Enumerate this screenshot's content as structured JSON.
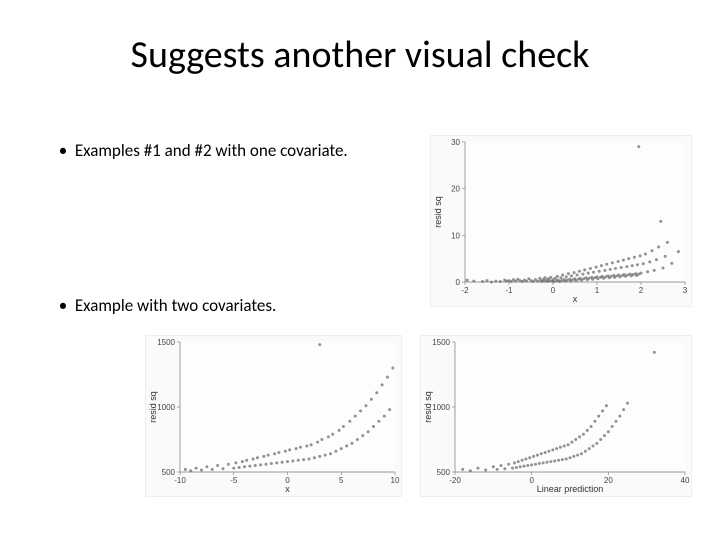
{
  "title": "Suggests another visual check",
  "bullets": {
    "b1": "Examples #1 and #2 with one covariate.",
    "b2": "Example with two covariates."
  },
  "chart_data": [
    {
      "type": "scatter",
      "title": "",
      "xlabel": "x",
      "ylabel": "resid sq",
      "xlim": [
        -2,
        3
      ],
      "ylim": [
        0,
        30
      ],
      "xticks": [
        -2,
        -1,
        0,
        1,
        2,
        3
      ],
      "yticks": [
        0,
        10,
        20,
        30
      ],
      "series": [
        {
          "name": "resid sq",
          "points": [
            [
              -1.95,
              0.4
            ],
            [
              -1.8,
              0.2
            ],
            [
              -1.6,
              0.1
            ],
            [
              -1.5,
              0.3
            ],
            [
              -1.4,
              0.0
            ],
            [
              -1.3,
              0.2
            ],
            [
              -1.2,
              0.1
            ],
            [
              -1.1,
              0.4
            ],
            [
              -1.05,
              0.2
            ],
            [
              -1.0,
              0.3
            ],
            [
              -0.95,
              0.1
            ],
            [
              -0.9,
              0.5
            ],
            [
              -0.85,
              0.2
            ],
            [
              -0.8,
              0.6
            ],
            [
              -0.75,
              0.3
            ],
            [
              -0.7,
              0.1
            ],
            [
              -0.65,
              0.4
            ],
            [
              -0.6,
              0.2
            ],
            [
              -0.55,
              0.7
            ],
            [
              -0.5,
              0.3
            ],
            [
              -0.45,
              0.1
            ],
            [
              -0.4,
              0.5
            ],
            [
              -0.35,
              0.2
            ],
            [
              -0.3,
              0.8
            ],
            [
              -0.28,
              0.3
            ],
            [
              -0.25,
              0.1
            ],
            [
              -0.22,
              0.6
            ],
            [
              -0.2,
              0.2
            ],
            [
              -0.18,
              0.9
            ],
            [
              -0.15,
              0.4
            ],
            [
              -0.12,
              0.1
            ],
            [
              -0.1,
              0.7
            ],
            [
              -0.08,
              0.3
            ],
            [
              -0.05,
              1.0
            ],
            [
              -0.02,
              0.2
            ],
            [
              0.0,
              0.5
            ],
            [
              0.02,
              0.1
            ],
            [
              0.05,
              0.8
            ],
            [
              0.08,
              0.3
            ],
            [
              0.1,
              1.2
            ],
            [
              0.12,
              0.4
            ],
            [
              0.15,
              0.1
            ],
            [
              0.18,
              0.9
            ],
            [
              0.2,
              0.3
            ],
            [
              0.22,
              1.5
            ],
            [
              0.25,
              0.5
            ],
            [
              0.28,
              0.2
            ],
            [
              0.3,
              1.1
            ],
            [
              0.32,
              0.4
            ],
            [
              0.35,
              1.8
            ],
            [
              0.38,
              0.6
            ],
            [
              0.4,
              0.2
            ],
            [
              0.42,
              1.3
            ],
            [
              0.45,
              0.5
            ],
            [
              0.48,
              2.0
            ],
            [
              0.5,
              0.7
            ],
            [
              0.52,
              0.3
            ],
            [
              0.55,
              1.5
            ],
            [
              0.58,
              0.6
            ],
            [
              0.6,
              2.3
            ],
            [
              0.62,
              0.8
            ],
            [
              0.65,
              0.4
            ],
            [
              0.68,
              1.7
            ],
            [
              0.7,
              0.7
            ],
            [
              0.72,
              2.6
            ],
            [
              0.75,
              0.9
            ],
            [
              0.78,
              0.5
            ],
            [
              0.8,
              1.9
            ],
            [
              0.82,
              0.8
            ],
            [
              0.85,
              2.9
            ],
            [
              0.88,
              1.0
            ],
            [
              0.9,
              0.6
            ],
            [
              0.92,
              2.1
            ],
            [
              0.95,
              0.9
            ],
            [
              0.98,
              3.2
            ],
            [
              1.0,
              1.1
            ],
            [
              1.02,
              0.7
            ],
            [
              1.05,
              2.3
            ],
            [
              1.08,
              1.0
            ],
            [
              1.1,
              3.5
            ],
            [
              1.12,
              1.2
            ],
            [
              1.15,
              0.8
            ],
            [
              1.18,
              2.5
            ],
            [
              1.2,
              1.1
            ],
            [
              1.22,
              3.8
            ],
            [
              1.25,
              1.3
            ],
            [
              1.28,
              0.9
            ],
            [
              1.3,
              2.7
            ],
            [
              1.32,
              1.2
            ],
            [
              1.35,
              4.1
            ],
            [
              1.38,
              1.4
            ],
            [
              1.4,
              1.0
            ],
            [
              1.42,
              2.9
            ],
            [
              1.45,
              1.3
            ],
            [
              1.48,
              4.4
            ],
            [
              1.5,
              1.5
            ],
            [
              1.52,
              1.1
            ],
            [
              1.55,
              3.1
            ],
            [
              1.58,
              1.4
            ],
            [
              1.6,
              4.7
            ],
            [
              1.62,
              1.6
            ],
            [
              1.65,
              1.2
            ],
            [
              1.68,
              3.3
            ],
            [
              1.7,
              1.5
            ],
            [
              1.72,
              5.0
            ],
            [
              1.75,
              1.7
            ],
            [
              1.78,
              1.3
            ],
            [
              1.8,
              3.5
            ],
            [
              1.82,
              1.6
            ],
            [
              1.85,
              5.3
            ],
            [
              1.88,
              1.8
            ],
            [
              1.9,
              1.4
            ],
            [
              1.92,
              3.7
            ],
            [
              1.95,
              1.7
            ],
            [
              1.98,
              5.6
            ],
            [
              2.0,
              1.9
            ],
            [
              2.05,
              3.9
            ],
            [
              2.1,
              6.0
            ],
            [
              2.15,
              2.2
            ],
            [
              2.2,
              4.3
            ],
            [
              2.25,
              6.7
            ],
            [
              2.3,
              2.5
            ],
            [
              2.35,
              4.8
            ],
            [
              2.4,
              7.5
            ],
            [
              2.45,
              13.0
            ],
            [
              2.5,
              3.0
            ],
            [
              2.55,
              5.5
            ],
            [
              2.6,
              8.5
            ],
            [
              2.7,
              4.0
            ],
            [
              2.85,
              6.5
            ],
            [
              1.95,
              29.0
            ]
          ]
        }
      ]
    },
    {
      "type": "scatter",
      "title": "",
      "xlabel": "x",
      "ylabel": "resid sq",
      "xlim": [
        -10,
        10
      ],
      "ylim": [
        500,
        1500
      ],
      "xticks": [
        -10,
        -5,
        0,
        5,
        10
      ],
      "yticks": [
        500,
        1000,
        1500
      ],
      "series": [
        {
          "name": "resid sq",
          "points": [
            [
              -9.5,
              520
            ],
            [
              -9.0,
              510
            ],
            [
              -8.5,
              530
            ],
            [
              -8.0,
              515
            ],
            [
              -7.5,
              540
            ],
            [
              -7.0,
              520
            ],
            [
              -6.5,
              550
            ],
            [
              -6.0,
              525
            ],
            [
              -5.5,
              560
            ],
            [
              -5.0,
              530
            ],
            [
              -4.8,
              570
            ],
            [
              -4.5,
              535
            ],
            [
              -4.2,
              580
            ],
            [
              -4.0,
              540
            ],
            [
              -3.8,
              590
            ],
            [
              -3.5,
              545
            ],
            [
              -3.2,
              600
            ],
            [
              -3.0,
              550
            ],
            [
              -2.8,
              610
            ],
            [
              -2.5,
              555
            ],
            [
              -2.2,
              620
            ],
            [
              -2.0,
              560
            ],
            [
              -1.8,
              630
            ],
            [
              -1.5,
              565
            ],
            [
              -1.2,
              640
            ],
            [
              -1.0,
              570
            ],
            [
              -0.8,
              650
            ],
            [
              -0.5,
              575
            ],
            [
              -0.2,
              660
            ],
            [
              0.0,
              580
            ],
            [
              0.2,
              670
            ],
            [
              0.5,
              585
            ],
            [
              0.8,
              680
            ],
            [
              1.0,
              590
            ],
            [
              1.2,
              690
            ],
            [
              1.5,
              595
            ],
            [
              1.8,
              700
            ],
            [
              2.0,
              600
            ],
            [
              2.2,
              710
            ],
            [
              2.5,
              610
            ],
            [
              2.8,
              730
            ],
            [
              3.0,
              620
            ],
            [
              3.2,
              750
            ],
            [
              3.5,
              630
            ],
            [
              3.8,
              770
            ],
            [
              4.0,
              640
            ],
            [
              4.2,
              790
            ],
            [
              4.5,
              660
            ],
            [
              4.8,
              820
            ],
            [
              5.0,
              680
            ],
            [
              5.2,
              850
            ],
            [
              5.5,
              700
            ],
            [
              5.8,
              890
            ],
            [
              6.0,
              720
            ],
            [
              6.3,
              930
            ],
            [
              6.5,
              750
            ],
            [
              6.8,
              970
            ],
            [
              7.0,
              780
            ],
            [
              7.3,
              1010
            ],
            [
              7.5,
              810
            ],
            [
              7.8,
              1060
            ],
            [
              8.0,
              850
            ],
            [
              8.3,
              1110
            ],
            [
              8.5,
              890
            ],
            [
              8.8,
              1170
            ],
            [
              9.0,
              930
            ],
            [
              9.3,
              1230
            ],
            [
              9.5,
              980
            ],
            [
              9.8,
              1300
            ],
            [
              3.0,
              1480
            ]
          ]
        }
      ]
    },
    {
      "type": "scatter",
      "title": "",
      "xlabel": "Linear prediction",
      "ylabel": "resid sq",
      "xlim": [
        -20,
        40
      ],
      "ylim": [
        500,
        1500
      ],
      "xticks": [
        -20,
        0,
        20,
        40
      ],
      "yticks": [
        500,
        1000,
        1500
      ],
      "series": [
        {
          "name": "resid sq",
          "points": [
            [
              -18,
              520
            ],
            [
              -16,
              510
            ],
            [
              -14,
              530
            ],
            [
              -12,
              515
            ],
            [
              -10,
              540
            ],
            [
              -9,
              520
            ],
            [
              -8,
              550
            ],
            [
              -7,
              525
            ],
            [
              -6,
              560
            ],
            [
              -5,
              530
            ],
            [
              -4.5,
              570
            ],
            [
              -4,
              535
            ],
            [
              -3.5,
              580
            ],
            [
              -3,
              540
            ],
            [
              -2.5,
              590
            ],
            [
              -2,
              545
            ],
            [
              -1.5,
              600
            ],
            [
              -1,
              550
            ],
            [
              -0.5,
              610
            ],
            [
              0,
              555
            ],
            [
              0.5,
              620
            ],
            [
              1,
              560
            ],
            [
              1.5,
              630
            ],
            [
              2,
              565
            ],
            [
              2.5,
              640
            ],
            [
              3,
              570
            ],
            [
              3.5,
              650
            ],
            [
              4,
              575
            ],
            [
              4.5,
              660
            ],
            [
              5,
              580
            ],
            [
              5.5,
              670
            ],
            [
              6,
              585
            ],
            [
              6.5,
              680
            ],
            [
              7,
              590
            ],
            [
              7.5,
              690
            ],
            [
              8,
              595
            ],
            [
              8.5,
              700
            ],
            [
              9,
              600
            ],
            [
              9.5,
              710
            ],
            [
              10,
              610
            ],
            [
              10.5,
              730
            ],
            [
              11,
              620
            ],
            [
              11.5,
              750
            ],
            [
              12,
              630
            ],
            [
              12.5,
              770
            ],
            [
              13,
              640
            ],
            [
              13.5,
              790
            ],
            [
              14,
              660
            ],
            [
              14.5,
              820
            ],
            [
              15,
              680
            ],
            [
              15.5,
              850
            ],
            [
              16,
              700
            ],
            [
              16.5,
              890
            ],
            [
              17,
              720
            ],
            [
              17.5,
              930
            ],
            [
              18,
              750
            ],
            [
              18.5,
              970
            ],
            [
              19,
              780
            ],
            [
              19.5,
              1010
            ],
            [
              20,
              810
            ],
            [
              21,
              850
            ],
            [
              22,
              890
            ],
            [
              23,
              930
            ],
            [
              24,
              980
            ],
            [
              25,
              1030
            ],
            [
              32,
              1420
            ]
          ]
        }
      ]
    }
  ]
}
